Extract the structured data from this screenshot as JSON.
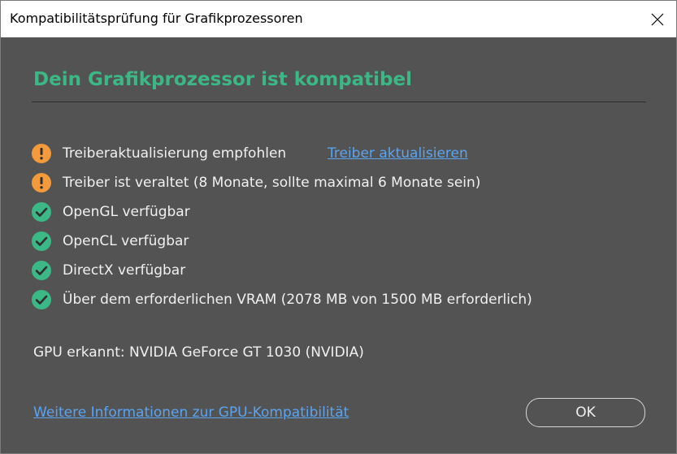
{
  "window": {
    "title": "Kompatibilitätsprüfung für Grafikprozessoren"
  },
  "heading": "Dein Grafikprozessor ist kompatibel",
  "colors": {
    "heading": "#3bb885",
    "warning": "#f29a3c",
    "success": "#3bb885",
    "link": "#5aa4f0",
    "background": "#535353"
  },
  "checks": [
    {
      "status": "warning",
      "icon": "warning-icon",
      "text": "Treiberaktualisierung empfohlen"
    },
    {
      "status": "warning",
      "icon": "warning-icon",
      "text": "Treiber ist veraltet (8 Monate, sollte maximal 6 Monate sein)"
    },
    {
      "status": "ok",
      "icon": "checkmark-icon",
      "text": "OpenGL verfügbar"
    },
    {
      "status": "ok",
      "icon": "checkmark-icon",
      "text": "OpenCL verfügbar"
    },
    {
      "status": "ok",
      "icon": "checkmark-icon",
      "text": "DirectX verfügbar"
    },
    {
      "status": "ok",
      "icon": "checkmark-icon",
      "text": "Über dem erforderlichen VRAM (2078 MB von 1500 MB erforderlich)"
    }
  ],
  "update_link": "Treiber aktualisieren",
  "gpu_detected": "GPU erkannt: NVIDIA GeForce GT 1030 (NVIDIA)",
  "info_link": "Weitere Informationen zur GPU-Kompatibilität",
  "ok_label": "OK"
}
